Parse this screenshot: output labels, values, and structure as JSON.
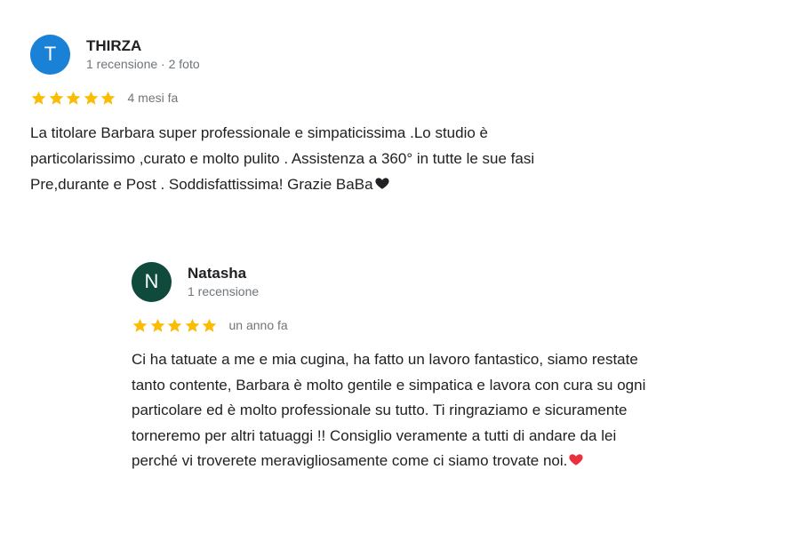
{
  "reviews": [
    {
      "avatar_letter": "T",
      "avatar_color": "#1a82d6",
      "name": "THIRZA",
      "meta": "1 recensione · 2 foto",
      "stars": 5,
      "date": "4 mesi fa",
      "text": "La titolare Barbara super professionale e simpaticissima .Lo studio è\nparticolarissimo ,curato e molto pulito . Assistenza a 360° in tutte le sue fasi\nPre,durante e Post . Soddisfattissima! Grazie BaBa",
      "trailing_icon": "black-heart-icon",
      "trailing_icon_color": "#202124"
    },
    {
      "avatar_letter": "N",
      "avatar_color": "#104a3c",
      "name": "Natasha",
      "meta": "1 recensione",
      "stars": 5,
      "date": "un anno fa",
      "text": "Ci ha tatuate a me e mia cugina, ha fatto un lavoro fantastico, siamo restate\ntanto contente, Barbara è molto gentile e simpatica e lavora con cura su ogni\nparticolare ed è molto professionale su tutto. Ti ringraziamo e sicuramente\ntorneremo per altri tatuaggi !! Consiglio veramente a tutti di andare da lei\nperché vi troverete meravigliosamente come ci siamo trovate noi.",
      "trailing_icon": "red-heart-icon",
      "trailing_icon_color": "#e8313c"
    }
  ],
  "colors": {
    "star": "#fbbc04",
    "text": "#202124",
    "muted": "#70757a"
  }
}
